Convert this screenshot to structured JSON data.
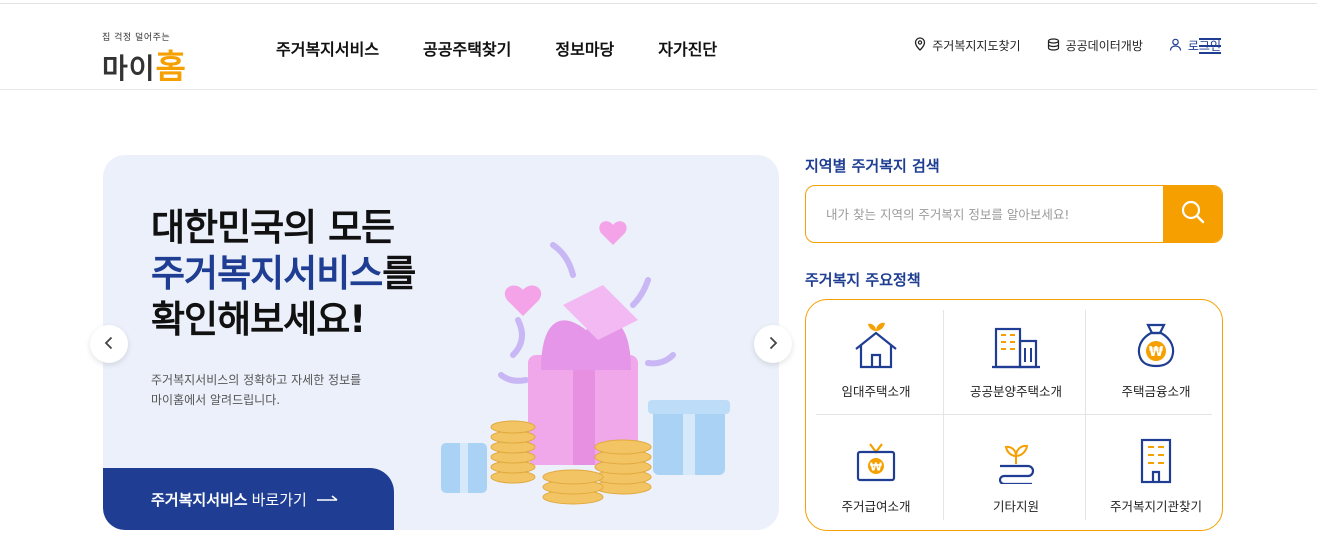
{
  "brand": {
    "tagline": "집 걱정 덜어주는",
    "name_part1": "마이",
    "name_part2": "홈",
    "accent_color": "#f5a000",
    "primary_color": "#1f3e93"
  },
  "gnb": [
    "주거복지서비스",
    "공공주택찾기",
    "정보마당",
    "자가진단"
  ],
  "util": {
    "map": "주거복지지도찾기",
    "open_data": "공공데이터개방",
    "login": "로그인",
    "map_icon": "map-pin-icon",
    "data_icon": "database-icon",
    "login_icon": "user-icon"
  },
  "hero": {
    "line1": "대한민국의 모든",
    "line2_highlight": "주거복지서비스",
    "line2_rest": "를",
    "line3": "확인해보세요!",
    "desc_line1": "주거복지서비스의 정확하고 자세한 정보를",
    "desc_line2": "마이홈에서 알려드립니다.",
    "cta_bold": "주거복지서비스",
    "cta_rest": "바로가기",
    "illustration": "gift-box-coins-illustration"
  },
  "search": {
    "title": "지역별 주거복지 검색",
    "placeholder": "내가 찾는 지역의 주거복지 정보를 알아보세요!",
    "button_icon": "search-icon"
  },
  "policy": {
    "title": "주거복지 주요정책",
    "items": [
      {
        "label": "임대주택소개",
        "icon": "house-sprout-icon"
      },
      {
        "label": "공공분양주택소개",
        "icon": "buildings-icon"
      },
      {
        "label": "주택금융소개",
        "icon": "money-bag-won-icon"
      },
      {
        "label": "주거급여소개",
        "icon": "gift-won-icon"
      },
      {
        "label": "기타지원",
        "icon": "sprout-hand-icon"
      },
      {
        "label": "주거복지기관찾기",
        "icon": "office-building-icon"
      }
    ]
  }
}
